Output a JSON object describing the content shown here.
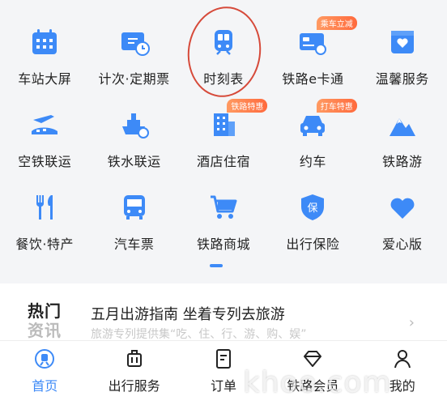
{
  "colors": {
    "accent": "#3d8af7",
    "annotation_red": "#d64a3a",
    "badge_orange": "#ff7a45"
  },
  "services": [
    {
      "label": "车站大屏",
      "icon": "calendar-screen-icon"
    },
    {
      "label": "计次·定期票",
      "icon": "ticket-clock-icon"
    },
    {
      "label": "时刻表",
      "icon": "train-icon"
    },
    {
      "label": "铁路e卡通",
      "icon": "card-icon",
      "badge": "乘车立减"
    },
    {
      "label": "温馨服务",
      "icon": "heart-box-icon"
    },
    {
      "label": "空铁联运",
      "icon": "plane-train-icon"
    },
    {
      "label": "铁水联运",
      "icon": "ship-icon"
    },
    {
      "label": "酒店住宿",
      "icon": "hotel-icon",
      "badge": "铁路特惠"
    },
    {
      "label": "约车",
      "icon": "car-icon",
      "badge": "打车特惠"
    },
    {
      "label": "铁路游",
      "icon": "mountain-icon"
    },
    {
      "label": "餐饮·特产",
      "icon": "fork-knife-icon"
    },
    {
      "label": "汽车票",
      "icon": "bus-icon"
    },
    {
      "label": "铁路商城",
      "icon": "cart-icon"
    },
    {
      "label": "出行保险",
      "icon": "shield-icon",
      "badge_text_in_icon": "保"
    },
    {
      "label": "爱心版",
      "icon": "heart-icon"
    }
  ],
  "news": {
    "tag_line1": "热门",
    "tag_line2": "资讯",
    "title": "五月出游指南 坐着专列去旅游",
    "subtitle": "旅游专列提供集“吃、住、行、游、购、娱”",
    "arrow": "›"
  },
  "tabs": [
    {
      "label": "首页",
      "icon": "home-train-icon",
      "active": true
    },
    {
      "label": "出行服务",
      "icon": "luggage-icon"
    },
    {
      "label": "订单",
      "icon": "order-icon"
    },
    {
      "label": "铁路会员",
      "icon": "diamond-icon"
    },
    {
      "label": "我的",
      "icon": "person-icon"
    }
  ],
  "watermark": "khoo.com"
}
